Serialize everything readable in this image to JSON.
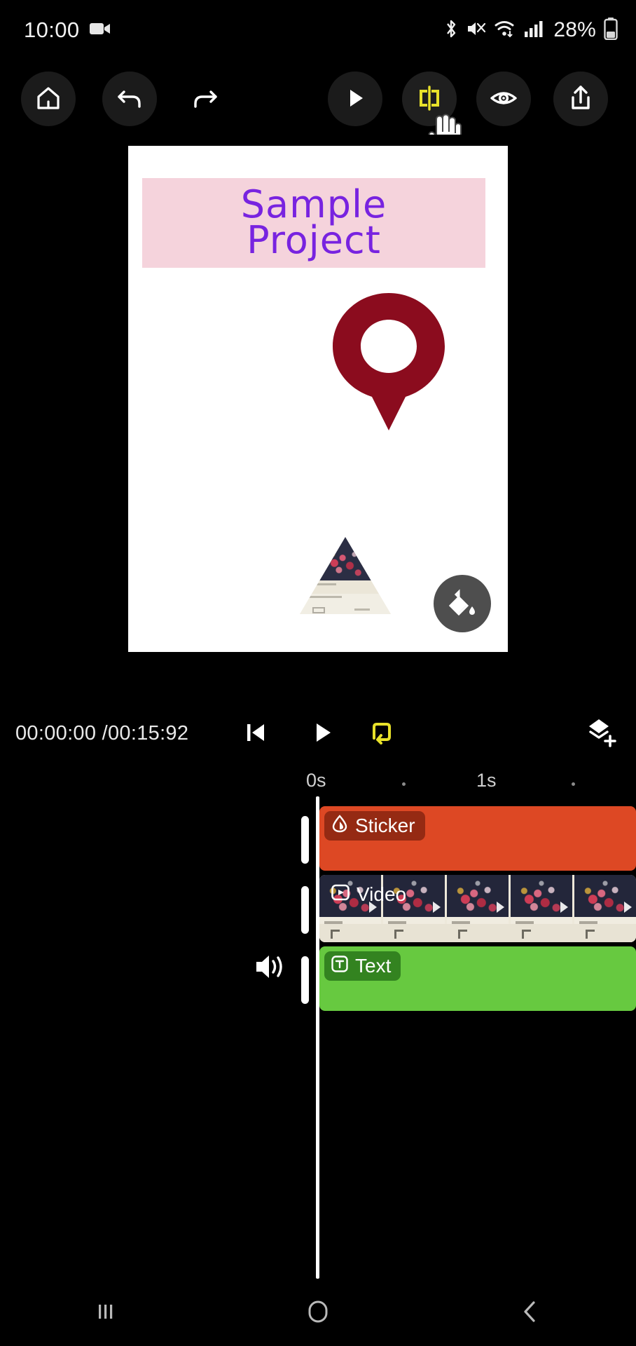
{
  "status_bar": {
    "time": "10:00",
    "recording_icon": "video-camera-icon",
    "icons": [
      "bluetooth-icon",
      "mute-icon",
      "wifi-icon",
      "cellular-signal-icon"
    ],
    "battery_percent": "28%",
    "battery_icon": "battery-icon"
  },
  "toolbar": {
    "home_label": "home-icon",
    "undo_label": "undo-icon",
    "redo_label": "redo-icon",
    "play_label": "play-icon",
    "split_label": "split-icon",
    "preview_label": "eye-icon",
    "export_label": "share-icon",
    "split_active_color": "#e8e12a"
  },
  "canvas": {
    "background": "#ffffff",
    "title_text": "Sample\nProject",
    "title_color": "#7823e0",
    "title_band_color": "#f5d3dc",
    "pin_sticker": {
      "name": "location-pin-sticker",
      "color": "#8b0c1e"
    },
    "triangle_clip": {
      "name": "triangle-video-clip"
    },
    "fill_button_label": "fill-bucket-icon",
    "fill_button_color": "#4e4e4e"
  },
  "transport": {
    "current_time": "00:00:00",
    "separator": "/",
    "total_time": "00:15:92",
    "time_readout": "00:00:00 /00:15:92",
    "skip_start_label": "skip-to-start-icon",
    "play_label": "play-icon",
    "loop_label": "loop-icon",
    "loop_color": "#e8e12a",
    "add_layer_label": "add-layer-icon"
  },
  "timeline": {
    "ruler": {
      "labels": [
        "0s",
        "1s"
      ],
      "tick_dots": 2
    },
    "volume_icon": "volume-icon",
    "tracks": [
      {
        "name": "sticker-track",
        "label": "Sticker",
        "icon": "sticker-icon",
        "color": "#dd4824"
      },
      {
        "name": "video-track",
        "label": "Video",
        "icon": "video-icon",
        "color": "#ede8da"
      },
      {
        "name": "text-track",
        "label": "Text",
        "icon": "text-icon",
        "color": "#67c940"
      }
    ],
    "playhead_color": "#ffffff"
  },
  "nav_bar": {
    "recents_label": "recents-icon",
    "home_label": "home-circle-icon",
    "back_label": "back-icon"
  },
  "cursor": {
    "name": "hand-pointer-cursor"
  }
}
